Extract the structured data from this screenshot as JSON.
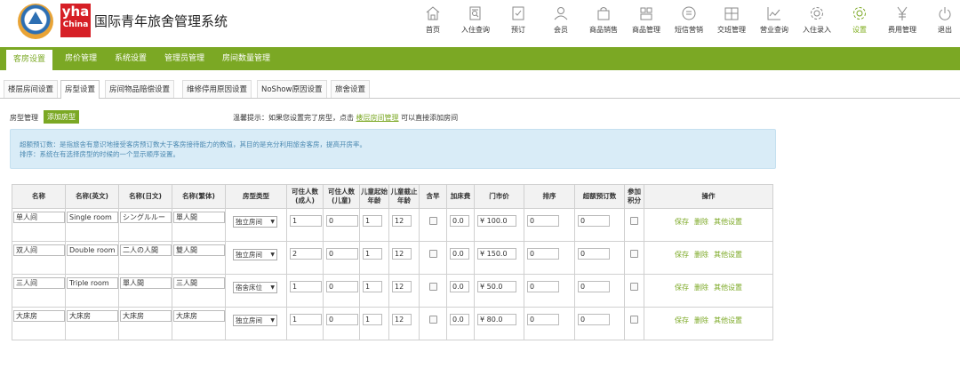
{
  "app": {
    "logo_top": "yha",
    "logo_bottom": "China",
    "title": "国际青年旅舍管理系统"
  },
  "nav": [
    {
      "label": "首页",
      "icon": "home-icon"
    },
    {
      "label": "入住查询",
      "icon": "checkin-query-icon"
    },
    {
      "label": "预订",
      "icon": "booking-icon"
    },
    {
      "label": "会员",
      "icon": "member-icon"
    },
    {
      "label": "商品销售",
      "icon": "shopping-bag-icon"
    },
    {
      "label": "商品管理",
      "icon": "goods-grid-icon"
    },
    {
      "label": "短信营销",
      "icon": "sms-icon"
    },
    {
      "label": "交班管理",
      "icon": "shift-icon"
    },
    {
      "label": "营业查询",
      "icon": "chart-icon"
    },
    {
      "label": "入住录入",
      "icon": "gear-outline-icon"
    },
    {
      "label": "设置",
      "icon": "settings-icon"
    },
    {
      "label": "费用管理",
      "icon": "yen-icon"
    },
    {
      "label": "退出",
      "icon": "power-icon"
    }
  ],
  "active_nav": "设置",
  "main_tabs": [
    "客房设置",
    "房价管理",
    "系统设置",
    "管理员管理",
    "房间数量管理"
  ],
  "sub_tabs": [
    "楼层房间设置",
    "房型设置",
    "房间物品赔偿设置",
    "维修停用原因设置",
    "NoShow原因设置",
    "旅舍设置"
  ],
  "room_type": {
    "label": "房型管理",
    "add_button": "添加房型",
    "tip_prefix": "温馨提示：如果您设置完了房型，点击",
    "tip_link": "楼层房间管理",
    "tip_suffix": "可以直接添加房间"
  },
  "info": {
    "line1": "超额预订数：是指旅舍有意识地接受客房预订数大于客房接待能力的数值，其目的是充分利用旅舍客房，提高开房率。",
    "line2": "排序：系统在有选择房型的时候的一个显示顺序设置。"
  },
  "table": {
    "headers": [
      "名称",
      "名称(英文)",
      "名称(日文)",
      "名称(繁体)",
      "房型类型",
      "可住人数(成人)",
      "可住人数(儿童)",
      "儿童起始年龄",
      "儿童截止年龄",
      "含早",
      "加床费",
      "门市价",
      "排序",
      "超额预订数",
      "参加积分",
      "操作"
    ],
    "currency": "¥",
    "ops": [
      "保存",
      "删除",
      "其他设置"
    ],
    "rows": [
      {
        "name": "单人间",
        "en": "Single room",
        "jp": "シングルルー",
        "tw": "單人間",
        "type": "独立房间",
        "adult": "1",
        "child": "0",
        "age_from": "1",
        "age_to": "12",
        "extra_bed": "0.0",
        "price": "100.0",
        "sort": "0",
        "overbook": "0"
      },
      {
        "name": "双人间",
        "en": "Double room",
        "jp": "二人の人間",
        "tw": "雙人間",
        "type": "独立房间",
        "adult": "2",
        "child": "0",
        "age_from": "1",
        "age_to": "12",
        "extra_bed": "0.0",
        "price": "150.0",
        "sort": "0",
        "overbook": "0"
      },
      {
        "name": "三人间",
        "en": "Triple room",
        "jp": "單人間",
        "tw": "三人間",
        "type": "宿舍床位",
        "adult": "1",
        "child": "0",
        "age_from": "1",
        "age_to": "12",
        "extra_bed": "0.0",
        "price": "50.0",
        "sort": "0",
        "overbook": "0"
      },
      {
        "name": "大床房",
        "en": "大床房",
        "jp": "大床房",
        "tw": "大床房",
        "type": "独立房间",
        "adult": "1",
        "child": "0",
        "age_from": "1",
        "age_to": "12",
        "extra_bed": "0.0",
        "price": "80.0",
        "sort": "0",
        "overbook": "0"
      }
    ]
  },
  "colors": {
    "brand_green": "#7ba824",
    "info_bg": "#d9ecf7",
    "logo_red": "#d61f26"
  }
}
